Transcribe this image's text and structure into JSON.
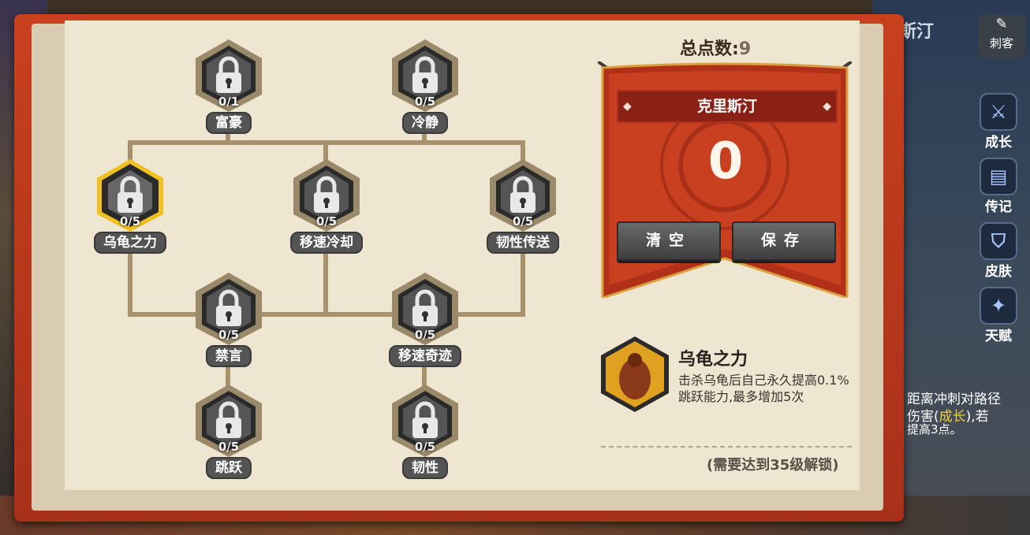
{
  "header": {
    "total_label": "总点数:",
    "total_value": "9"
  },
  "hero": {
    "name": "克里斯汀",
    "points_used": "0",
    "clear_label": "清空",
    "save_label": "保存"
  },
  "nodes": [
    {
      "id": "rich",
      "label": "富豪",
      "count": "0/1",
      "state": "locked"
    },
    {
      "id": "calm",
      "label": "冷静",
      "count": "0/5",
      "state": "locked"
    },
    {
      "id": "turtle",
      "label": "乌龟之力",
      "count": "0/5",
      "state": "selected"
    },
    {
      "id": "speed_cd",
      "label": "移速冷却",
      "count": "0/5",
      "state": "locked"
    },
    {
      "id": "tough_tp",
      "label": "韧性传送",
      "count": "0/5",
      "state": "locked"
    },
    {
      "id": "silence",
      "label": "禁言",
      "count": "0/5",
      "state": "locked"
    },
    {
      "id": "speed_miracle",
      "label": "移速奇迹",
      "count": "0/5",
      "state": "locked"
    },
    {
      "id": "jump",
      "label": "跳跃",
      "count": "0/5",
      "state": "locked"
    },
    {
      "id": "tough",
      "label": "韧性",
      "count": "0/5",
      "state": "locked"
    }
  ],
  "detail": {
    "title": "乌龟之力",
    "description": "击杀乌龟后自己永久提高0.1%跳跃能力,最多增加5次",
    "unlock_requirement": "(需要达到35级解锁)"
  },
  "side_menu": {
    "class_label": "刺客",
    "hero_name_partial": "斯汀",
    "items": [
      "成长",
      "传记",
      "皮肤",
      "天赋"
    ]
  },
  "background_text": {
    "line1": "距离冲刺对路径",
    "line2_a": "伤害(",
    "line2_b": "成长",
    "line2_c": "),若",
    "line3": "提高3点。"
  },
  "colors": {
    "accent": "#c8401e",
    "page": "#efe6d1",
    "selected": "#f0c020"
  }
}
